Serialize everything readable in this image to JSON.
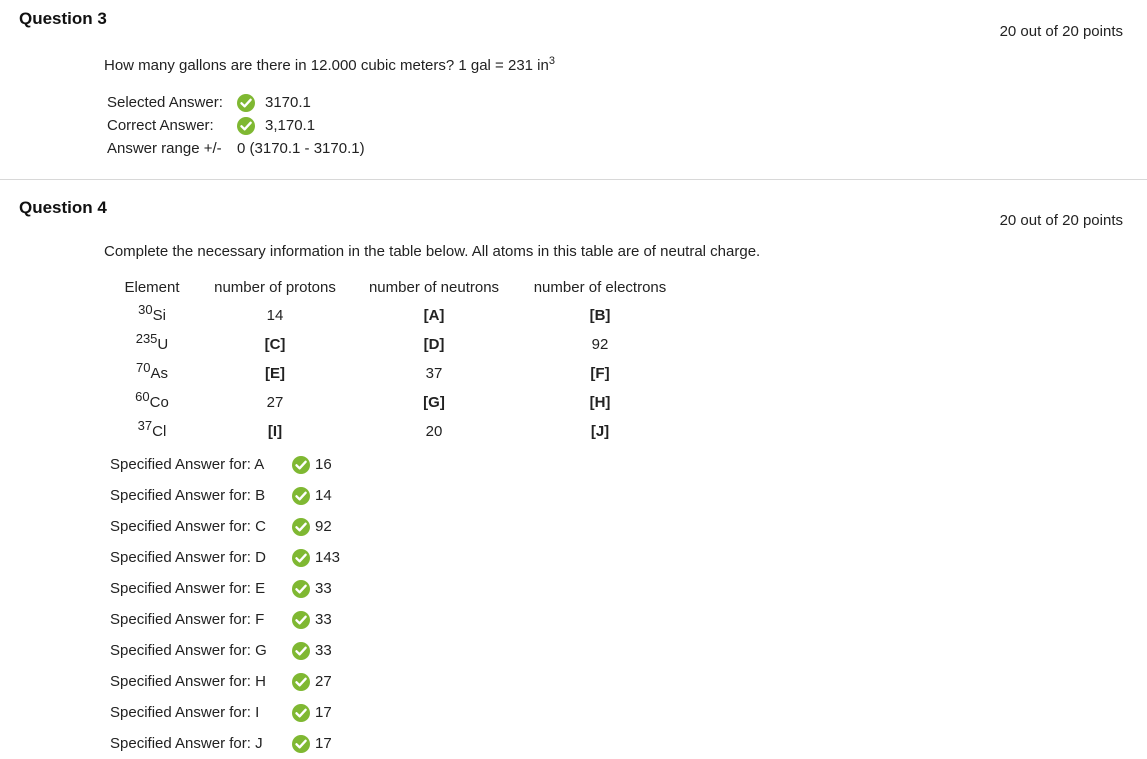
{
  "q3": {
    "title": "Question 3",
    "points": "20 out of 20 points",
    "question": "How many gallons are there in 12.000 cubic meters? 1 gal = 231 in",
    "question_sup": "3",
    "selected_label": "Selected Answer:",
    "selected_value": "3170.1",
    "correct_label": "Correct Answer:",
    "correct_value": "3,170.1",
    "range_label": "Answer range +/-",
    "range_value": "0 (3170.1 - 3170.1)"
  },
  "q4": {
    "title": "Question 4",
    "points": "20 out of 20 points",
    "question": "Complete the necessary information in the table below. All atoms in this table are of neutral charge.",
    "table": {
      "headers": [
        "Element",
        "number of protons",
        "number of neutrons",
        "number of electrons"
      ],
      "rows": [
        {
          "mass": "30",
          "symbol": "Si",
          "protons": "14",
          "neutrons": "[A]",
          "electrons": "[B]"
        },
        {
          "mass": "235",
          "symbol": "U",
          "protons": "[C]",
          "neutrons": "[D]",
          "electrons": "92"
        },
        {
          "mass": "70",
          "symbol": "As",
          "protons": "[E]",
          "neutrons": "37",
          "electrons": "[F]"
        },
        {
          "mass": "60",
          "symbol": "Co",
          "protons": "27",
          "neutrons": "[G]",
          "electrons": "[H]"
        },
        {
          "mass": "37",
          "symbol": "Cl",
          "protons": "[I]",
          "neutrons": "20",
          "electrons": "[J]"
        }
      ]
    },
    "specified": [
      {
        "label": "Specified Answer for: A",
        "value": "16"
      },
      {
        "label": "Specified Answer for: B",
        "value": "14"
      },
      {
        "label": "Specified Answer for: C",
        "value": "92"
      },
      {
        "label": "Specified Answer for: D",
        "value": "143"
      },
      {
        "label": "Specified Answer for: E",
        "value": "33"
      },
      {
        "label": "Specified Answer for: F",
        "value": "33"
      },
      {
        "label": "Specified Answer for: G",
        "value": "33"
      },
      {
        "label": "Specified Answer for: H",
        "value": "27"
      },
      {
        "label": "Specified Answer for: I",
        "value": "17"
      },
      {
        "label": "Specified Answer for: J",
        "value": "17"
      }
    ]
  },
  "icons": {
    "correct": "check-circle-icon"
  },
  "colors": {
    "check": "#7fb832"
  }
}
